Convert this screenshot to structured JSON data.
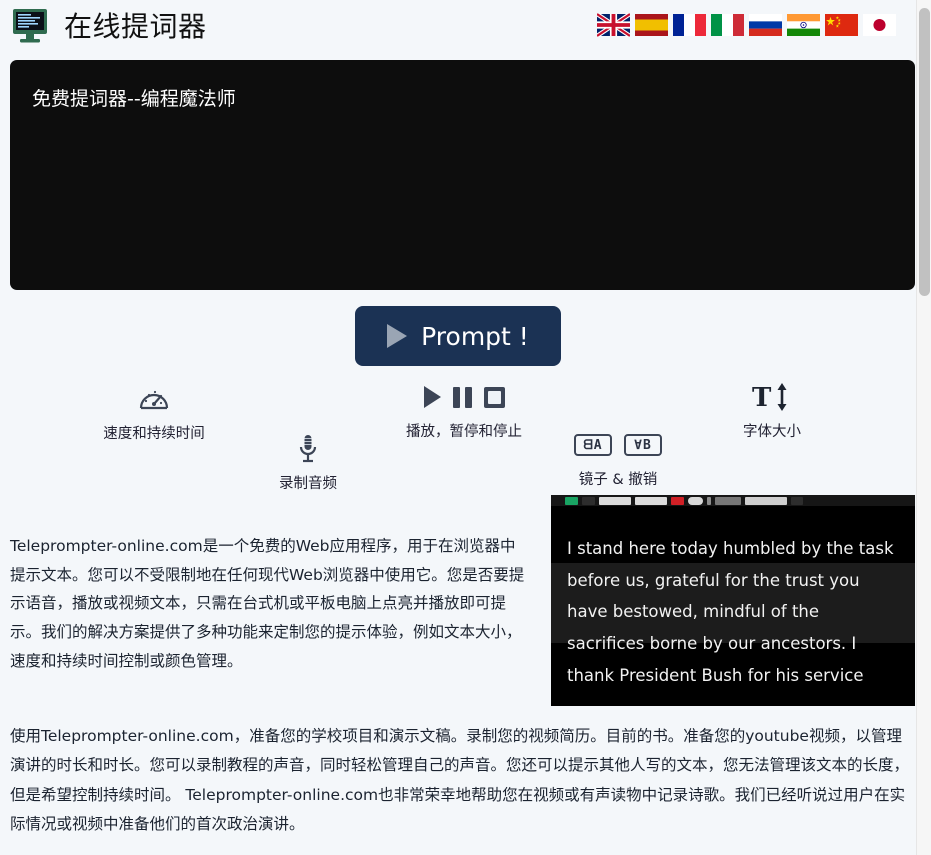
{
  "header": {
    "logo_icon": "crt-monitor-icon",
    "title": "在线提词器",
    "flags": [
      {
        "code": "gb",
        "name": "flag-united-kingdom"
      },
      {
        "code": "es",
        "name": "flag-spain"
      },
      {
        "code": "fr",
        "name": "flag-france"
      },
      {
        "code": "it",
        "name": "flag-italy"
      },
      {
        "code": "ru",
        "name": "flag-russia"
      },
      {
        "code": "in",
        "name": "flag-india"
      },
      {
        "code": "cn",
        "name": "flag-china"
      },
      {
        "code": "jp",
        "name": "flag-japan"
      }
    ]
  },
  "prompter": {
    "text": "免费提词器--编程魔法师",
    "background": "#0d0d0d",
    "text_color": "#ffffff"
  },
  "prompt_button": {
    "label": "Prompt !",
    "icon": "play-icon",
    "background": "#1b3254",
    "text_color": "#ffffff"
  },
  "features": {
    "speed": {
      "caption": "速度和持续时间",
      "icon": "speedometer-icon"
    },
    "playback": {
      "caption": "播放，暂停和停止",
      "icons": [
        "play-icon",
        "pause-icon",
        "stop-icon"
      ]
    },
    "font_size": {
      "caption": "字体大小",
      "icon": "font-size-icon",
      "glyph": "T"
    },
    "record_audio": {
      "caption": "录制音频",
      "icon": "microphone-icon"
    },
    "mirror": {
      "caption": "镜子 & 撤销",
      "icons": [
        "mirror-horizontal-icon",
        "mirror-vertical-icon"
      ],
      "glyph_h": "ᗺA",
      "glyph_v": "∀B"
    }
  },
  "body": {
    "paragraph_left": "Teleprompter-online.com是一个免费的Web应用程序，用于在浏览器中提示文本。您可以不受限制地在任何现代Web浏览器中使用它。您是否要提示语音，播放或视频文本，只需在台式机或平板电脑上点亮并播放即可提示。我们的解决方案提供了多种功能来定制您的提示体验，例如文本大小，速度和持续时间控制或颜色管理。",
    "paragraph_bottom": "使用Teleprompter-online.com，准备您的学校项目和演示文稿。录制您的视频简历。目前的书。准备您的youtube视频，以管理演讲的时长和时长。您可以录制教程的声音，同时轻松管理自己的声音。您还可以提示其他人写的文本，您无法管理该文本的长度，但是希望控制持续时间。 Teleprompter-online.com也非常荣幸地帮助您在视频或有声读物中记录诗歌。我们已经听说过用户在实际情况或视频中准备他们的首次政治演讲。"
  },
  "video": {
    "caption_text": "I stand here today humbled by the task before us, grateful for the trust you have bestowed, mindful of the sacrifices borne by our ancestors. I thank President Bush for his service",
    "background": "#000000",
    "text_color": "#f2f2f2"
  },
  "scrollbar": {
    "thumb_color": "#c1c1c1",
    "track_color": "#f6f6f6"
  }
}
